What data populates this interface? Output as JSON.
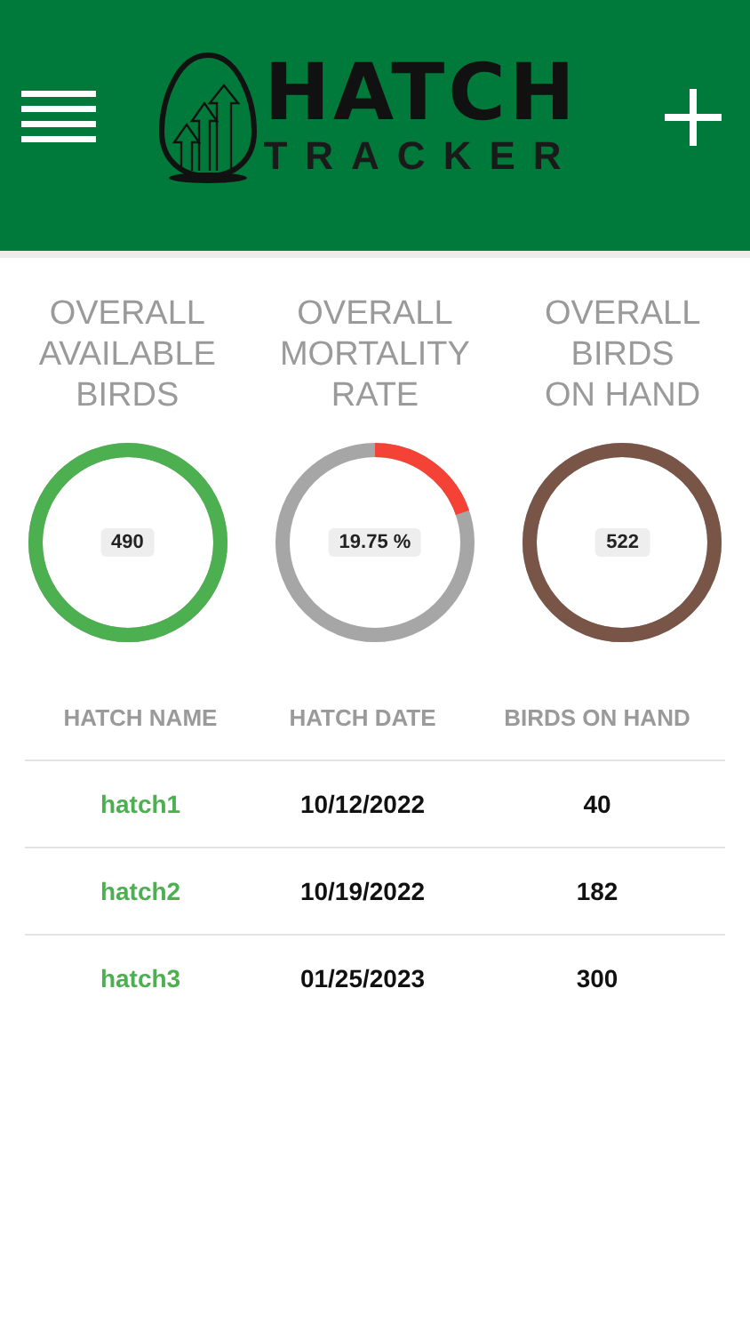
{
  "header": {
    "logo_top": "HATCH",
    "logo_bottom": "TRACKER"
  },
  "stats": [
    {
      "title": "OVERALL\nAVAILABLE\nBIRDS",
      "value": "490",
      "color": "#4caf50",
      "level": 1
    },
    {
      "title": "OVERALL\nMORTALITY\nRATE",
      "value": "19.75 %",
      "color": "#f44336",
      "level": 0.1975
    },
    {
      "title": "OVERALL\nBIRDS\nON HAND",
      "value": "522",
      "color": "#795548",
      "level": 1
    }
  ],
  "table": {
    "columns": [
      "HATCH NAME",
      "HATCH DATE",
      "BIRDS ON HAND"
    ],
    "rows": [
      [
        "hatch1",
        "10/12/2022",
        "40"
      ],
      [
        "hatch2",
        "10/19/2022",
        "182"
      ],
      [
        "hatch3",
        "01/25/2023",
        "300"
      ]
    ]
  }
}
